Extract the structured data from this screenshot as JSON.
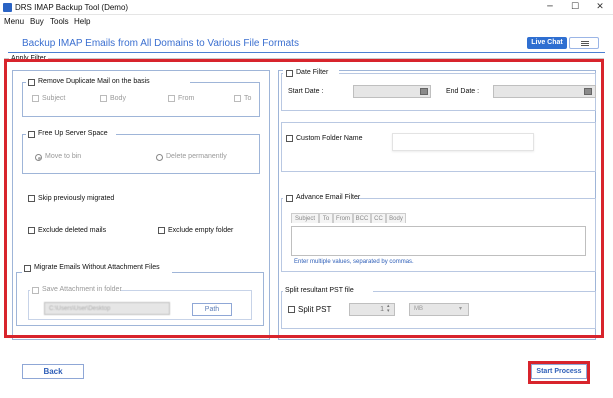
{
  "window": {
    "title": "DRS IMAP Backup Tool (Demo)",
    "min": "─",
    "max": "☐",
    "close": "✕"
  },
  "menu": [
    "Menu",
    "Buy",
    "Tools",
    "Help"
  ],
  "header": {
    "title": "Backup IMAP Emails from All Domains to Various File Formats",
    "live_chat": "Live Chat"
  },
  "apply_filter": {
    "legend": "Apply Filter"
  },
  "duplicate": {
    "label": "Remove Duplicate Mail on the basis",
    "options": [
      "Subject",
      "Body",
      "From",
      "To"
    ]
  },
  "free_up": {
    "label": "Free Up Server Space",
    "options": [
      "Move to bin",
      "Delete permanently"
    ]
  },
  "skip_migrated": "Skip previously migrated",
  "exclude_deleted": "Exclude deleted mails",
  "exclude_empty": "Exclude empty folder",
  "migrate_without_attachment": {
    "label": "Migrate Emails Without Attachment Files",
    "save_attachment": "Save Attachment in folder",
    "path_value": "C:\\Users\\User\\Desktop",
    "path_button": "Path"
  },
  "date_filter": {
    "label": "Date Filter",
    "start_label": "Start Date :",
    "end_label": "End Date :"
  },
  "custom_folder": {
    "label": "Custom Folder Name"
  },
  "advance_email": {
    "label": "Advance Email Filter",
    "tabs": [
      "Subject",
      "To",
      "From",
      "BCC",
      "CC",
      "Body"
    ],
    "hint": "Enter multiple values, separated by commas."
  },
  "split": {
    "legend": "Split resultant PST file",
    "label": "Split PST",
    "value": "1",
    "unit": "MB"
  },
  "buttons": {
    "back": "Back",
    "start": "Start Process"
  },
  "colors": {
    "accent": "#2f6fd1",
    "highlight": "#d8242c"
  }
}
